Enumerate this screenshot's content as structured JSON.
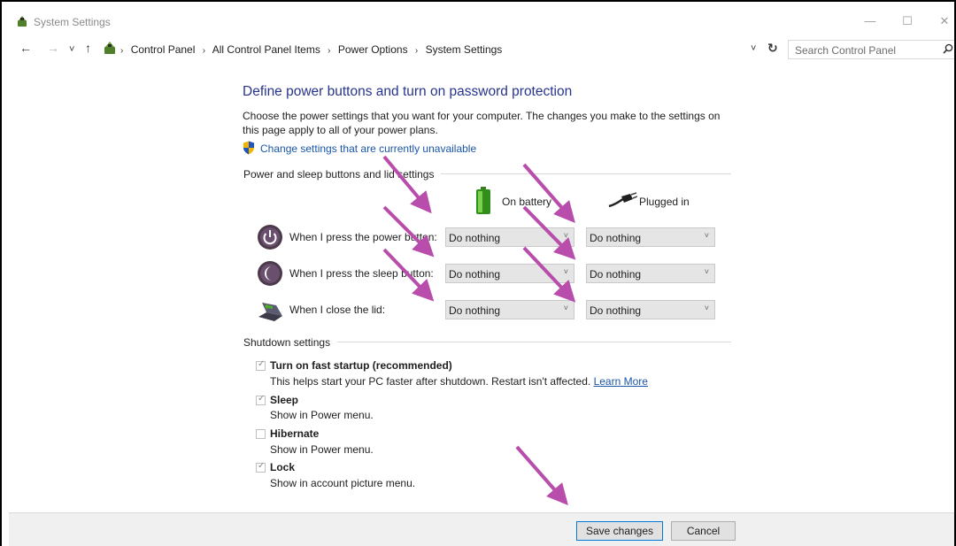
{
  "window": {
    "title": "System Settings",
    "minimize_glyph": "—",
    "maximize_glyph": "☐",
    "close_glyph": "✕"
  },
  "address_bar": {
    "back_glyph": "←",
    "forward_glyph": "→",
    "recent_glyph": "˅",
    "up_glyph": "↑",
    "breadcrumbs": [
      "Control Panel",
      "All Control Panel Items",
      "Power Options",
      "System Settings"
    ],
    "separator": "›",
    "dropdown_glyph": "˅",
    "refresh_glyph": "↻",
    "search_placeholder": "Search Control Panel"
  },
  "main": {
    "heading": "Define power buttons and turn on password protection",
    "description": "Choose the power settings that you want for your computer. The changes you make to the settings on this page apply to all of your power plans.",
    "change_settings_link": "Change settings that are currently unavailable",
    "power_group": {
      "label": "Power and sleep buttons and lid settings",
      "col_battery": "On battery",
      "col_plugged": "Plugged in",
      "rows": [
        {
          "label": "When I press the power button:",
          "battery": "Do nothing",
          "plugged": "Do nothing"
        },
        {
          "label": "When I press the sleep button:",
          "battery": "Do nothing",
          "plugged": "Do nothing"
        },
        {
          "label": "When I close the lid:",
          "battery": "Do nothing",
          "plugged": "Do nothing"
        }
      ]
    },
    "shutdown_group": {
      "label": "Shutdown settings",
      "items": [
        {
          "title": "Turn on fast startup (recommended)",
          "desc": "This helps start your PC faster after shutdown. Restart isn't affected.",
          "link": "Learn More",
          "checked": true
        },
        {
          "title": "Sleep",
          "desc": "Show in Power menu.",
          "checked": true
        },
        {
          "title": "Hibernate",
          "desc": "Show in Power menu.",
          "checked": false
        },
        {
          "title": "Lock",
          "desc": "Show in account picture menu.",
          "checked": true
        }
      ]
    }
  },
  "footer": {
    "save_label": "Save changes",
    "cancel_label": "Cancel"
  },
  "colors": {
    "annotation_arrow": "#b84dab",
    "heading": "#27348b",
    "link": "#1a56a8"
  },
  "chevron_glyph": "˅",
  "check_glyph": "✓"
}
